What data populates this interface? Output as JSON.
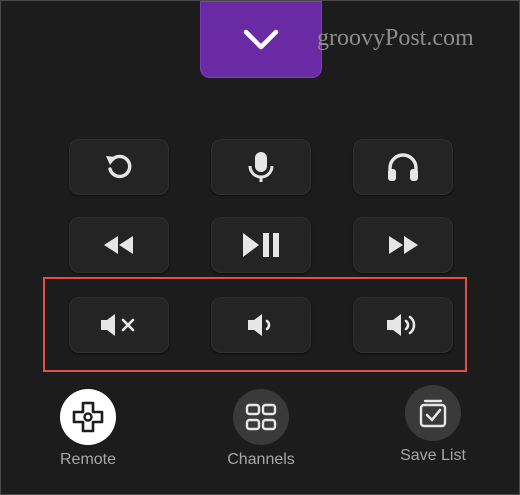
{
  "watermark": "groovyPost.com",
  "top_button": {
    "icon": "chevron-down-icon",
    "color": "#6a2aa3"
  },
  "rows": [
    [
      "replay-icon",
      "microphone-icon",
      "headphones-icon"
    ],
    [
      "rewind-icon",
      "play-pause-icon",
      "fast-forward-icon"
    ],
    [
      "mute-icon",
      "volume-down-icon",
      "volume-up-icon"
    ]
  ],
  "highlight_color": "#e34d4d",
  "nav": {
    "items": [
      {
        "label": "Remote",
        "icon": "remote-dpad-icon",
        "active": true
      },
      {
        "label": "Channels",
        "icon": "channels-grid-icon",
        "active": false
      },
      {
        "label": "Save List",
        "icon": "save-list-icon",
        "active": false
      }
    ]
  }
}
